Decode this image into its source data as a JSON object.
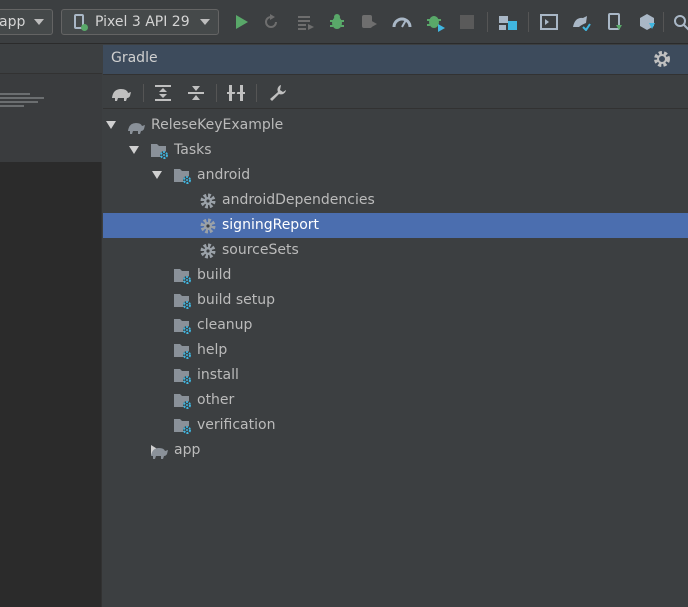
{
  "toolbar": {
    "run_config": "app",
    "device": "Pixel 3 API 29",
    "icons": [
      "run-icon",
      "rerun-icon",
      "apply-changes-icon",
      "debug-icon",
      "attach-debugger-icon",
      "profile-icon",
      "coverage-icon",
      "stop-icon",
      "project-structure-icon",
      "terminal-icon",
      "sync-gradle-icon",
      "device-manager-icon",
      "sdk-manager-icon",
      "search-icon"
    ]
  },
  "gradle": {
    "title": "Gradle",
    "tools": [
      "elephant-icon",
      "expand-all-icon",
      "collapse-all-icon",
      "toggle-offline-icon",
      "wrench-icon"
    ]
  },
  "tree": [
    {
      "label": "ReleseKeyExample",
      "kind": "project",
      "expanded": true,
      "indent": 0
    },
    {
      "label": "Tasks",
      "kind": "folder",
      "expanded": true,
      "indent": 1
    },
    {
      "label": "android",
      "kind": "folder",
      "expanded": true,
      "indent": 2
    },
    {
      "label": "androidDependencies",
      "kind": "task",
      "indent": 3
    },
    {
      "label": "signingReport",
      "kind": "task",
      "indent": 3,
      "selected": true
    },
    {
      "label": "sourceSets",
      "kind": "task",
      "indent": 3
    },
    {
      "label": "build",
      "kind": "folder",
      "expanded": false,
      "indent": 2
    },
    {
      "label": "build setup",
      "kind": "folder",
      "expanded": false,
      "indent": 2
    },
    {
      "label": "cleanup",
      "kind": "folder",
      "expanded": false,
      "indent": 2
    },
    {
      "label": "help",
      "kind": "folder",
      "expanded": false,
      "indent": 2
    },
    {
      "label": "install",
      "kind": "folder",
      "expanded": false,
      "indent": 2
    },
    {
      "label": "other",
      "kind": "folder",
      "expanded": false,
      "indent": 2
    },
    {
      "label": "verification",
      "kind": "folder",
      "expanded": false,
      "indent": 2
    },
    {
      "label": "app",
      "kind": "project",
      "expanded": false,
      "indent": 1
    }
  ],
  "colors": {
    "selection": "#4b6eaf",
    "run_green": "#59a869",
    "gear_blue": "#40b6e0",
    "header_blue": "#3d4b5c"
  }
}
